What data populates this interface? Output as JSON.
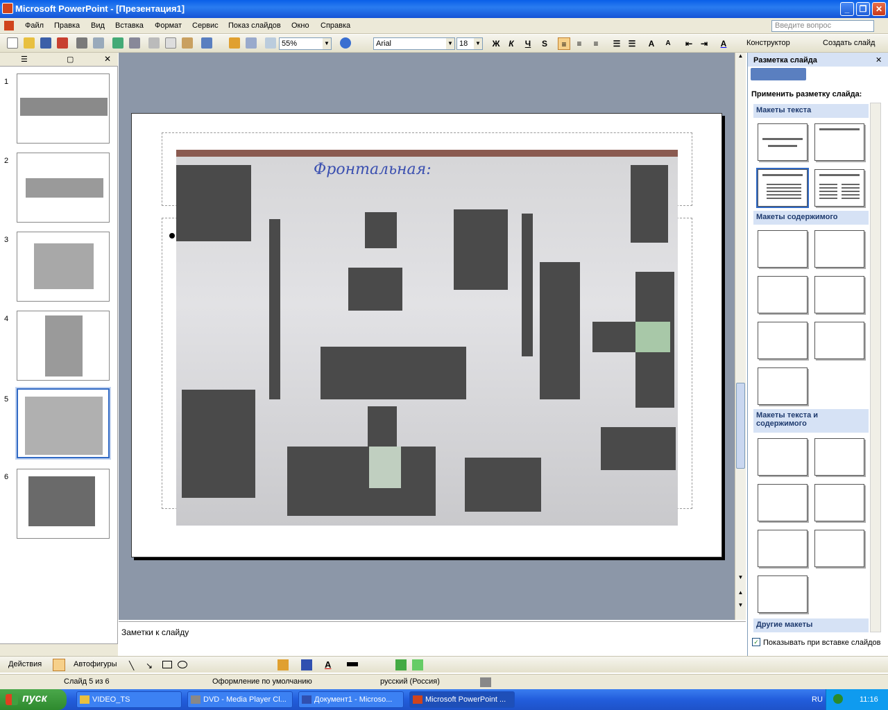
{
  "window": {
    "title": "Microsoft PowerPoint - [Презентация1]"
  },
  "menu": {
    "items": [
      "Файл",
      "Правка",
      "Вид",
      "Вставка",
      "Формат",
      "Сервис",
      "Показ слайдов",
      "Окно",
      "Справка"
    ],
    "ask_placeholder": "Введите вопрос"
  },
  "toolbar": {
    "zoom": "55%",
    "font": "Arial",
    "size": "18",
    "bold": "Ж",
    "italic": "К",
    "underline": "Ч",
    "shadow": "S",
    "designer": "Конструктор",
    "new_slide": "Создать слайд"
  },
  "outline": {
    "slides": [
      "1",
      "2",
      "3",
      "4",
      "5",
      "6"
    ],
    "selected": 5
  },
  "slide": {
    "photo_title": "Фронтальная:"
  },
  "notes": {
    "placeholder": "Заметки к слайду"
  },
  "taskpane": {
    "title": "Разметка слайда",
    "apply_label": "Применить разметку слайда:",
    "sections": [
      "Макеты текста",
      "Макеты содержимого",
      "Макеты текста и содержимого",
      "Другие макеты"
    ],
    "show_on_insert": "Показывать при вставке слайдов"
  },
  "drawbar": {
    "actions": "Действия",
    "autoshapes": "Автофигуры"
  },
  "status": {
    "slide": "Слайд 5 из 6",
    "design": "Оформление по умолчанию",
    "lang": "русский (Россия)"
  },
  "taskbar": {
    "start": "пуск",
    "tasks": [
      "VIDEO_TS",
      "DVD - Media Player Cl...",
      "Документ1 - Microso...",
      "Microsoft PowerPoint ..."
    ],
    "lang": "RU",
    "time": "11:16"
  },
  "colors": {
    "titlebar": "#0a5fe8",
    "accent": "#316ac5",
    "workspace": "#8c97a8"
  }
}
